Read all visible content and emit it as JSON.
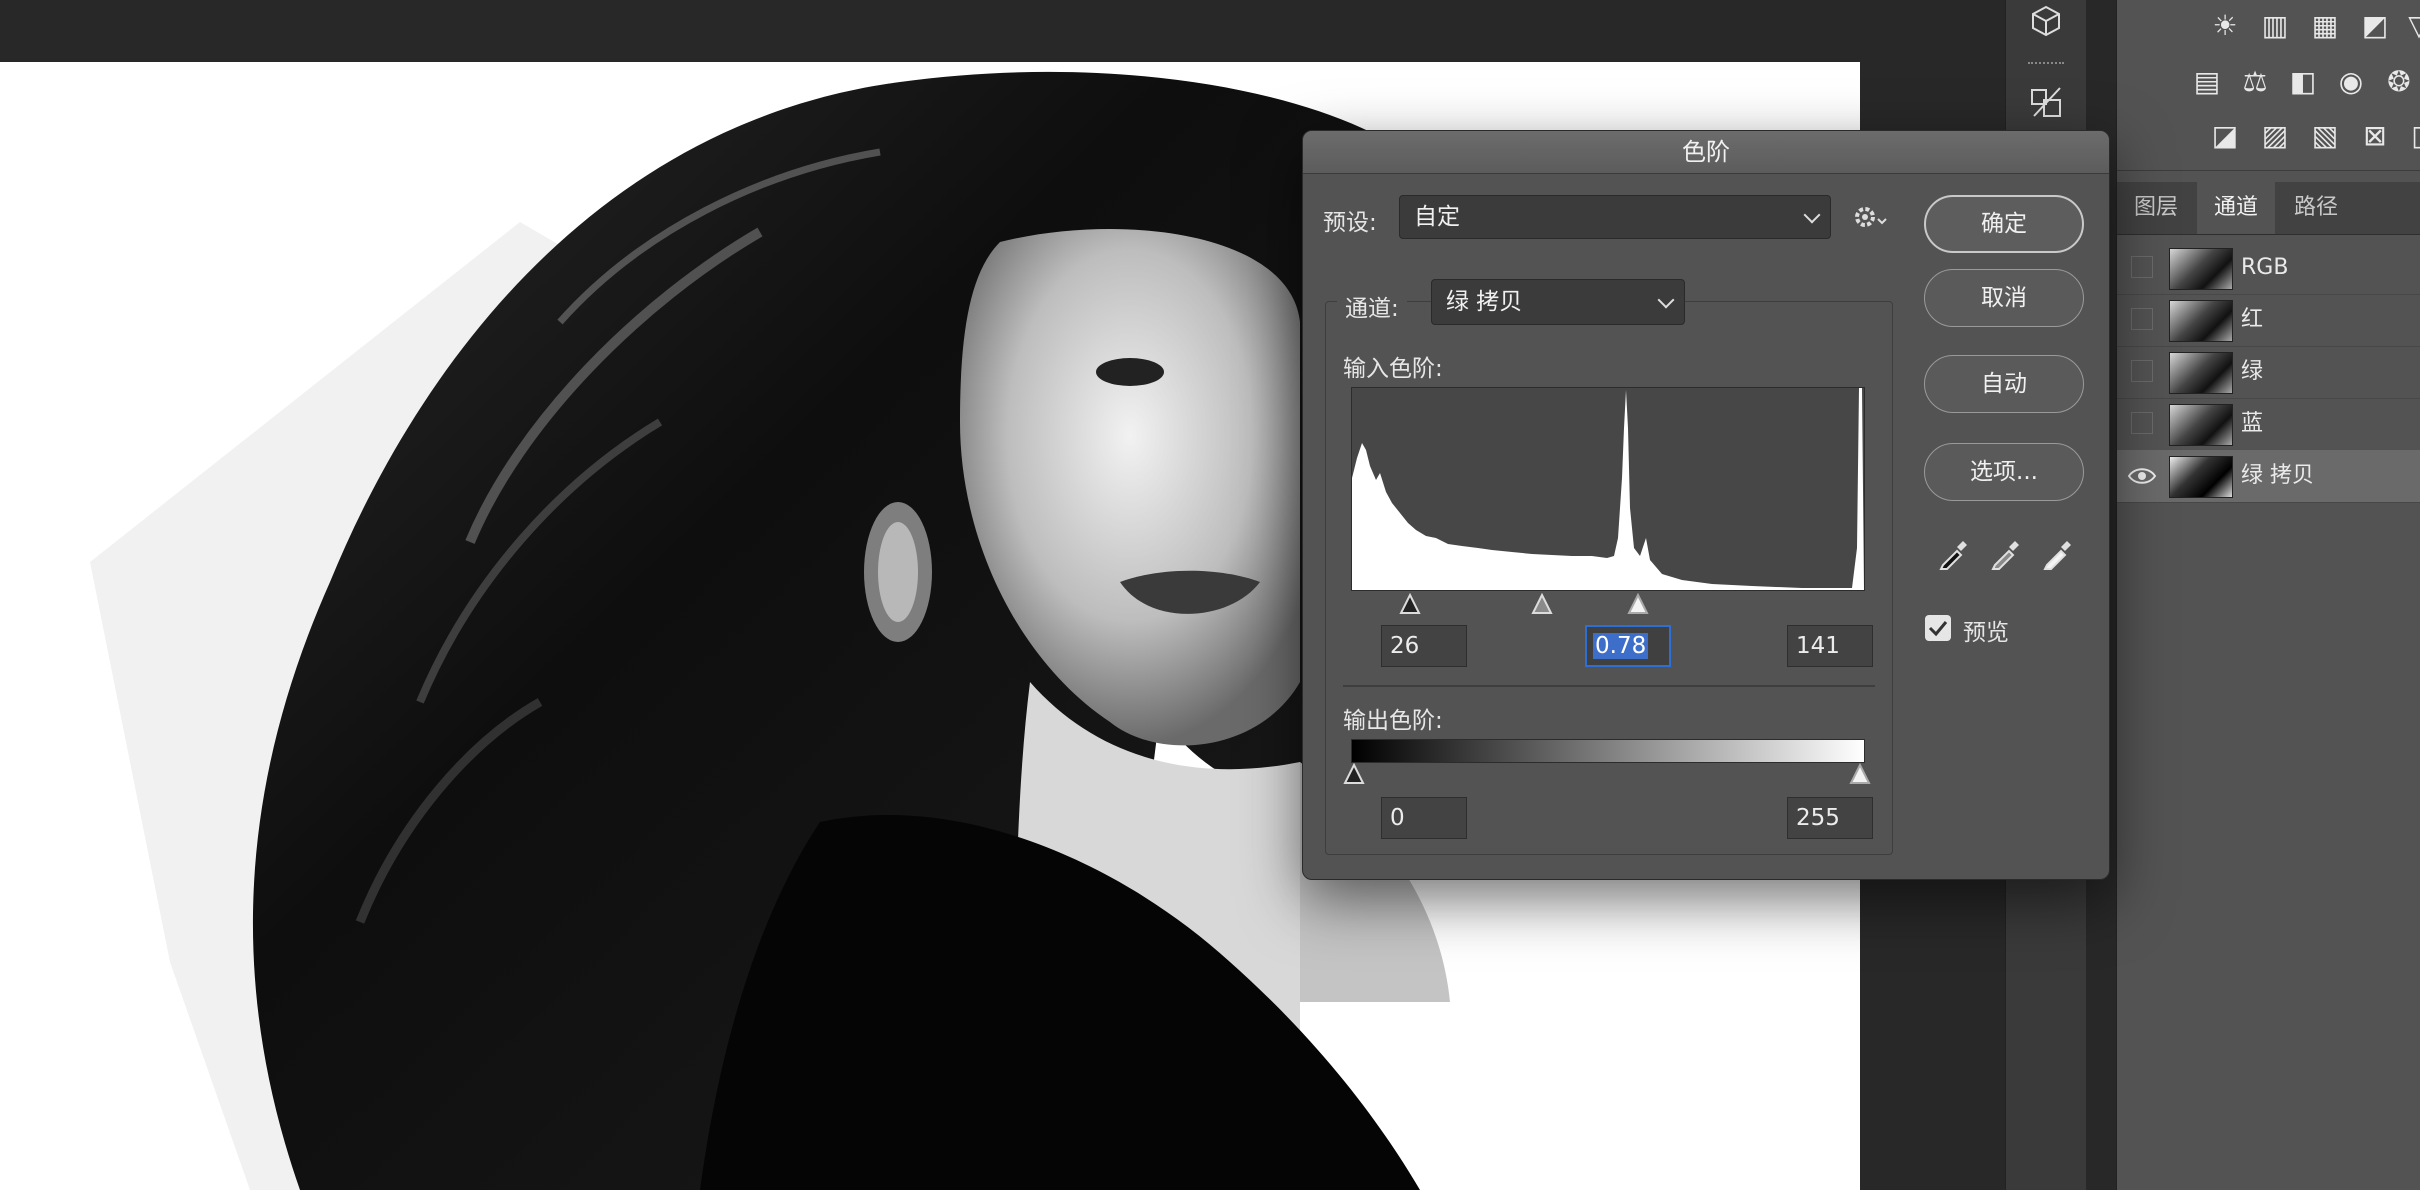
{
  "dialog": {
    "title": "色阶",
    "preset_label": "预设:",
    "preset_value": "自定",
    "channel_label": "通道:",
    "channel_value": "绿 拷贝",
    "input_levels_label": "输入色阶:",
    "output_levels_label": "输出色阶:",
    "input_black": "26",
    "input_gamma": "0.78",
    "input_white": "141",
    "output_black": "0",
    "output_white": "255",
    "buttons": {
      "ok": "确定",
      "cancel": "取消",
      "auto": "自动",
      "options": "选项..."
    },
    "preview_label": "预览",
    "preview_checked": true,
    "gear_icon": "gear-icon",
    "eyedropper_icons": [
      "black-eyedropper-icon",
      "gray-eyedropper-icon",
      "white-eyedropper-icon"
    ]
  },
  "panel": {
    "tabs": [
      "图层",
      "通道",
      "路径"
    ],
    "active_tab": "通道",
    "channels": [
      {
        "label": "RGB",
        "visible": false,
        "selected": false
      },
      {
        "label": "红",
        "visible": false,
        "selected": false
      },
      {
        "label": "绿",
        "visible": false,
        "selected": false
      },
      {
        "label": "蓝",
        "visible": false,
        "selected": false
      },
      {
        "label": "绿 拷贝",
        "visible": true,
        "selected": true
      }
    ]
  },
  "colors": {
    "panel_bg": "#535353",
    "selection_blue": "#3d6ec9",
    "canvas_bg": "#282828"
  }
}
